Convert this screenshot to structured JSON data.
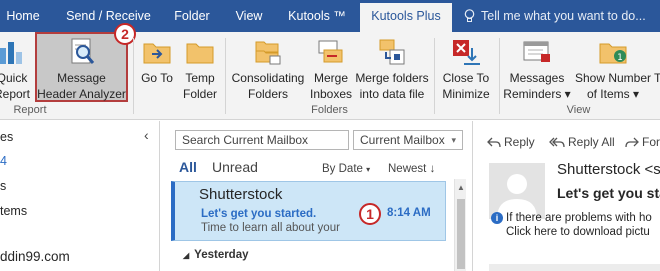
{
  "tabs": [
    {
      "label": "Home"
    },
    {
      "label": "Send / Receive"
    },
    {
      "label": "Folder"
    },
    {
      "label": "View"
    },
    {
      "label": "Kutools ™"
    },
    {
      "label": "Kutools Plus"
    }
  ],
  "tell_me": "Tell me what you want to do...",
  "ribbon": {
    "buttons": [
      {
        "label_1": "Quick",
        "label_2": "Report"
      },
      {
        "label_1": "Message",
        "label_2": "Header Analyzer"
      },
      {
        "label_1": "Go To",
        "label_2": ""
      },
      {
        "label_1": "Temp",
        "label_2": "Folder"
      },
      {
        "label_1": "Consolidating",
        "label_2": "Folders"
      },
      {
        "label_1": "Merge",
        "label_2": "Inboxes"
      },
      {
        "label_1": "Merge folders",
        "label_2": "into data file"
      },
      {
        "label_1": "Close To",
        "label_2": "Minimize"
      },
      {
        "label_1": "Messages",
        "label_2": "Reminders ▾"
      },
      {
        "label_1": "Show Number",
        "label_2": "of Items ▾"
      },
      {
        "label_1": "T",
        "label_2": ""
      }
    ],
    "groups": {
      "report": "Report",
      "folders": "Folders",
      "view": "View"
    },
    "badges": {
      "step1": "1",
      "step2": "2"
    }
  },
  "folder_pane": {
    "items": [
      "es",
      "4",
      "s",
      "tems",
      "ddin99.com"
    ],
    "collapse": "‹"
  },
  "message_list": {
    "search_placeholder": "Search Current Mailbox",
    "scope": "Current Mailbox",
    "filter_all": "All",
    "filter_unread": "Unread",
    "sort_by": "By Date",
    "sort_order": "Newest",
    "selected_mail": {
      "sender": "Shutterstock",
      "subject": "Let's get you started.",
      "time": "8:14 AM",
      "preview": "Time to learn all about your"
    },
    "group_header": "Yesterday"
  },
  "reading_pane": {
    "reply": "Reply",
    "reply_all": "Reply All",
    "forward": "For",
    "sender": "Shutterstock <sh",
    "subject": "Let's get you sta",
    "info_1": "If there are problems with ho",
    "info_2": "Click here to download pictu"
  },
  "colors": {
    "accent": "#2b579a",
    "highlight": "#cde6f7",
    "badge": "#c62828"
  }
}
